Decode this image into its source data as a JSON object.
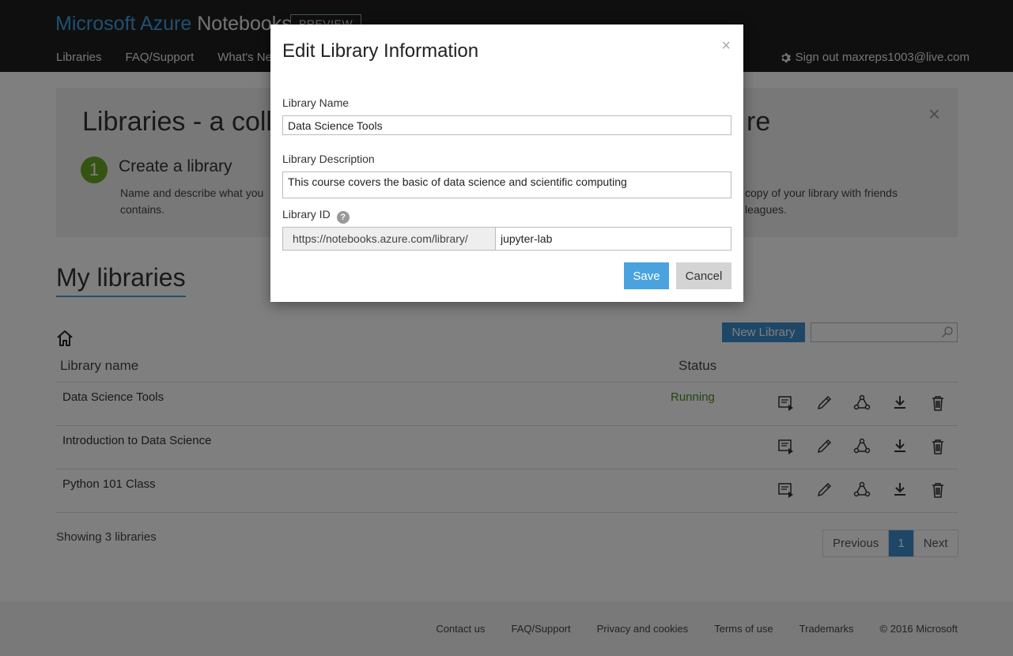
{
  "header": {
    "brand_ms": "Microsoft Azure",
    "brand_nb": "Notebooks",
    "badge": "PREVIEW",
    "nav": [
      "Libraries",
      "FAQ/Support",
      "What's Ne"
    ],
    "signout": "Sign out maxreps1003@live.com"
  },
  "banner": {
    "title_left": "Libraries - a colle",
    "title_right": "re",
    "close": "×",
    "step_number": "1",
    "step_title": "Create a library",
    "step_desc_line1": "Name and describe what you",
    "step_desc_line2": "contains.",
    "right_desc_line1": "copy of your library with friends",
    "right_desc_line2": "leagues."
  },
  "main": {
    "heading": "My libraries",
    "new_library": "New Library",
    "search_placeholder": "",
    "col_name": "Library name",
    "col_status": "Status",
    "rows": [
      {
        "name": "Data Science Tools",
        "status": "Running"
      },
      {
        "name": "Introduction to Data Science",
        "status": ""
      },
      {
        "name": "Python 101 Class",
        "status": ""
      }
    ],
    "showing": "Showing 3 libraries",
    "pager": {
      "prev": "Previous",
      "current": "1",
      "next": "Next"
    }
  },
  "footer": {
    "links": [
      "Contact us",
      "FAQ/Support",
      "Privacy and cookies",
      "Terms of use",
      "Trademarks",
      "© 2016 Microsoft"
    ]
  },
  "modal": {
    "title": "Edit Library Information",
    "close": "×",
    "name_label": "Library Name",
    "name_value": "Data Science Tools",
    "desc_label": "Library Description",
    "desc_value": "This course covers the basic of data science and scientific computing",
    "id_label": "Library ID",
    "id_prefix": "https://notebooks.azure.com/library/",
    "id_value": "jupyter-lab",
    "save": "Save",
    "cancel": "Cancel"
  },
  "colors": {
    "accent": "#3c8fcf",
    "brand_blue": "#3fa2e0",
    "running_green": "#4a8a1a",
    "step_green": "#6aa824"
  }
}
